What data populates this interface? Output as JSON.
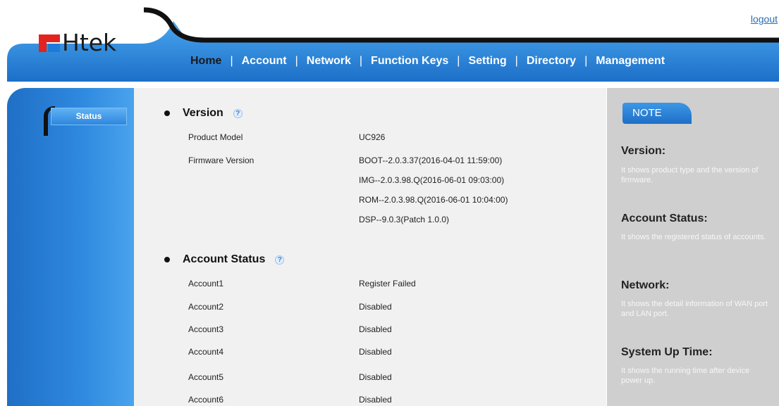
{
  "header": {
    "logout": "logout",
    "logo_text": "Htek",
    "nav": [
      "Home",
      "Account",
      "Network",
      "Function Keys",
      "Setting",
      "Directory",
      "Management"
    ],
    "nav_active": "Home",
    "separator": "|"
  },
  "sidebar": {
    "items": [
      {
        "label": "Status",
        "active": true
      }
    ]
  },
  "main": {
    "version": {
      "title": "Version",
      "help_icon": "help-icon",
      "rows": [
        {
          "label": "Product Model",
          "value": "UC926"
        },
        {
          "label": "Firmware Version",
          "value": "BOOT--2.0.3.37(2016-04-01 11:59:00)"
        },
        {
          "label": "",
          "value": "IMG--2.0.3.98.Q(2016-06-01 09:03:00)"
        },
        {
          "label": "",
          "value": "ROM--2.0.3.98.Q(2016-06-01 10:04:00)"
        },
        {
          "label": "",
          "value": "DSP--9.0.3(Patch 1.0.0)"
        }
      ]
    },
    "account_status": {
      "title": "Account Status",
      "help_icon": "help-icon",
      "rows": [
        {
          "label": "Account1",
          "value": "Register Failed"
        },
        {
          "label": "Account2",
          "value": "Disabled"
        },
        {
          "label": "Account3",
          "value": "Disabled"
        },
        {
          "label": "Account4",
          "value": "Disabled"
        },
        {
          "label": "Account5",
          "value": "Disabled"
        },
        {
          "label": "Account6",
          "value": "Disabled"
        }
      ]
    }
  },
  "note": {
    "tab": "NOTE",
    "sections": [
      {
        "heading": "Version:",
        "text": "It shows product type and the version of firmware."
      },
      {
        "heading": "Account Status:",
        "text": "It shows the registered status of accounts."
      },
      {
        "heading": "Network:",
        "text": "It shows the detail information of WAN port and LAN port."
      },
      {
        "heading": "System Up Time:",
        "text": "It shows the running time after device power up."
      }
    ]
  },
  "colors": {
    "nav_blue": "#2a86dc",
    "sidebar_blue": "#1f6fc5",
    "content_bg": "#f1f1f1",
    "note_bg": "#cfcfcf",
    "link": "#2a6db5"
  }
}
